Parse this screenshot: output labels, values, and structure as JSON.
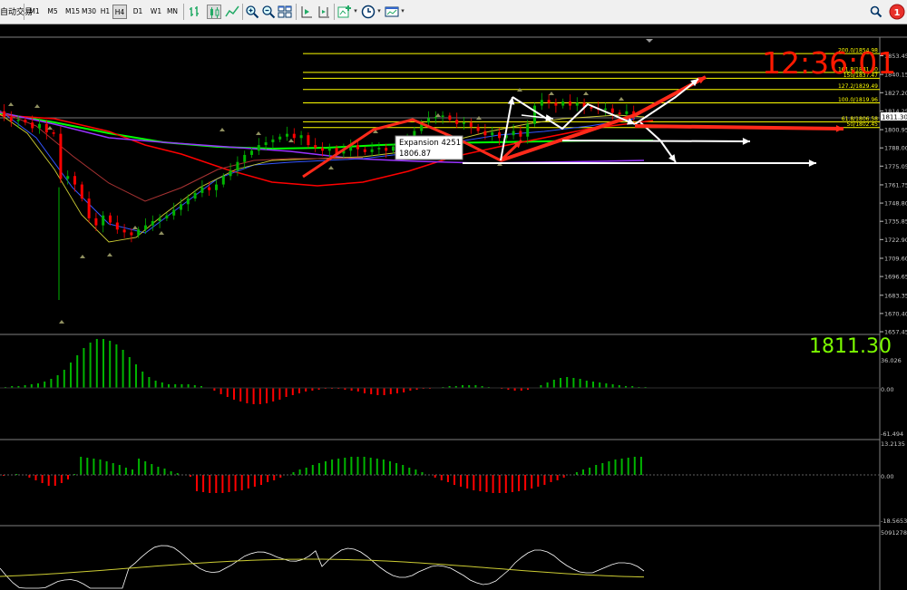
{
  "toolbar": {
    "left_label": "自动交易",
    "timeframes": [
      "M1",
      "M5",
      "M15",
      "M30",
      "H1",
      "H4",
      "D1",
      "W1",
      "MN"
    ],
    "active_timeframe": "H4",
    "notification_count": "1"
  },
  "clock": "12:36:01",
  "price_readout": "1811.30",
  "current_price_label": "1811.30",
  "tooltip": {
    "line1": "Expansion 4251",
    "line2": "1806.87"
  },
  "price_axis": {
    "min": 1657.45,
    "max": 1866.0,
    "ticks": [
      "1853.45",
      "1840.15",
      "1827.20",
      "1814.25",
      "1800.95",
      "1788.00",
      "1775.05",
      "1761.75",
      "1748.80",
      "1735.85",
      "1722.90",
      "1709.60",
      "1696.65",
      "1683.35",
      "1670.40",
      "1657.45"
    ]
  },
  "fib_levels": [
    {
      "label": "200.0/1854.98",
      "price": 1854.98
    },
    {
      "label": "161.8/1841.60",
      "price": 1841.6
    },
    {
      "label": "150/1837.47",
      "price": 1837.47
    },
    {
      "label": "127.2/1829.49",
      "price": 1829.49
    },
    {
      "label": "100.0/1819.96",
      "price": 1819.96
    },
    {
      "label": "61.8/1806.58",
      "price": 1806.58
    },
    {
      "label": "50/1802.45",
      "price": 1802.45
    }
  ],
  "macd": {
    "max_label": "36.026",
    "zero_label": "0.00",
    "min_label": "-61.494"
  },
  "osma": {
    "max_label": "13.2135",
    "zero_label": "0.00",
    "min_label": "-18.5653"
  },
  "volume_pane": {
    "max_label": "5091278"
  },
  "colors": {
    "bull": "#00b400",
    "bear": "#ff0000",
    "fib": "#ffff00",
    "wm": "#00ff00",
    "red_ma": "#ff0000",
    "green_ma": "#00ff00",
    "purple_ma": "#9933ff"
  }
}
